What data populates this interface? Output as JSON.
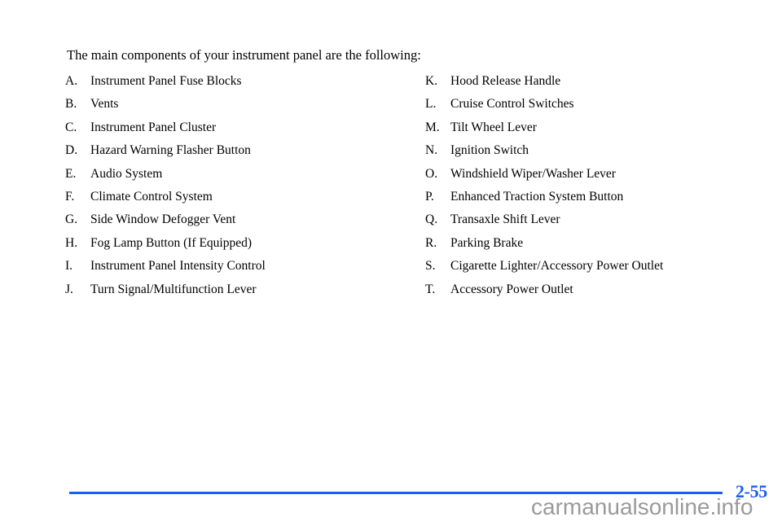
{
  "document": {
    "intro_text": "The main components of your instrument panel are the following:"
  },
  "components": {
    "left_column": [
      {
        "letter": "A.",
        "label": "Instrument Panel Fuse Blocks"
      },
      {
        "letter": "B.",
        "label": "Vents"
      },
      {
        "letter": "C.",
        "label": "Instrument Panel Cluster"
      },
      {
        "letter": "D.",
        "label": "Hazard Warning Flasher Button"
      },
      {
        "letter": "E.",
        "label": "Audio System"
      },
      {
        "letter": "F.",
        "label": "Climate Control System"
      },
      {
        "letter": "G.",
        "label": "Side Window Defogger Vent"
      },
      {
        "letter": "H.",
        "label": "Fog Lamp Button (If Equipped)"
      },
      {
        "letter": "I.",
        "label": "Instrument Panel Intensity Control"
      },
      {
        "letter": "J.",
        "label": "Turn Signal/Multifunction Lever"
      }
    ],
    "right_column": [
      {
        "letter": "K.",
        "label": "Hood Release Handle"
      },
      {
        "letter": "L.",
        "label": "Cruise Control Switches"
      },
      {
        "letter": "M.",
        "label": "Tilt Wheel Lever"
      },
      {
        "letter": "N.",
        "label": "Ignition Switch"
      },
      {
        "letter": "O.",
        "label": "Windshield Wiper/Washer Lever"
      },
      {
        "letter": "P.",
        "label": "Enhanced Traction System Button"
      },
      {
        "letter": "Q.",
        "label": "Transaxle Shift Lever"
      },
      {
        "letter": "R.",
        "label": "Parking Brake"
      },
      {
        "letter": "S.",
        "label": "Cigarette Lighter/Accessory Power Outlet"
      },
      {
        "letter": "T.",
        "label": "Accessory Power Outlet"
      }
    ]
  },
  "footer": {
    "page_number": "2-55",
    "rule_color": "#1a5cf5",
    "page_number_color": "#1a5cf5"
  },
  "watermark": {
    "text": "carmanualsonline.info",
    "color": "#9a9a9a"
  }
}
